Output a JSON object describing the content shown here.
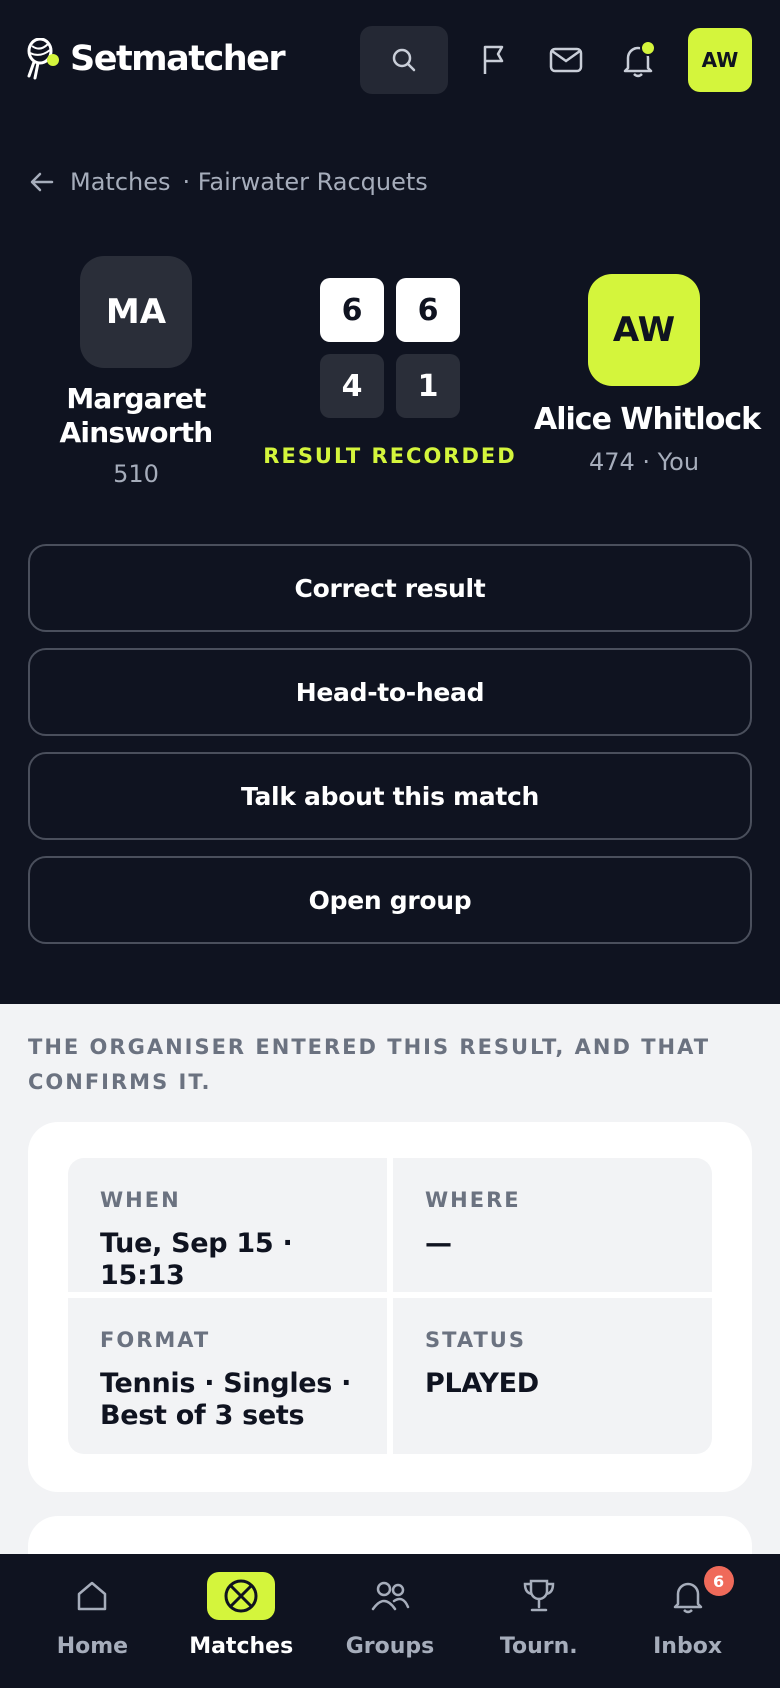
{
  "app": {
    "name": "Setmatcher"
  },
  "header": {
    "avatar_initials": "AW",
    "notification_dot_color": "#d4f53c",
    "icons": [
      "search-icon",
      "flag-icon",
      "mail-icon",
      "bell-icon"
    ]
  },
  "breadcrumb": {
    "parent": "Matches",
    "group": "· Fairwater Racquets"
  },
  "match": {
    "player_left": {
      "initials": "MA",
      "name_line1": "Margaret",
      "name_line2": "Ainsworth",
      "rating": "510"
    },
    "player_right": {
      "initials": "AW",
      "name": "Alice Whitlock",
      "rating": "474 · You"
    },
    "scores": {
      "set1": {
        "right": "6",
        "left": "4"
      },
      "set2": {
        "right": "6",
        "left": "1"
      }
    },
    "status_label": "RESULT RECORDED"
  },
  "actions": {
    "correct": "Correct result",
    "h2h": "Head-to-head",
    "talk": "Talk about this match",
    "group": "Open group"
  },
  "info": {
    "note": "THE ORGANISER ENTERED THIS RESULT, AND THAT CONFIRMS IT.",
    "when_label": "WHEN",
    "when_value": "Tue, Sep 15 · 15:13",
    "where_label": "WHERE",
    "where_value": "—",
    "format_label": "FORMAT",
    "format_value": "Tennis · Singles · Best of 3 sets",
    "status_label": "STATUS",
    "status_value": "PLAYED"
  },
  "nav": {
    "home": "Home",
    "matches": "Matches",
    "groups": "Groups",
    "tourn": "Tourn.",
    "inbox": "Inbox",
    "inbox_badge": "6"
  },
  "colors": {
    "accent": "#d4f53c",
    "dark_bg": "#0f1320",
    "badge": "#ef6a5a"
  }
}
